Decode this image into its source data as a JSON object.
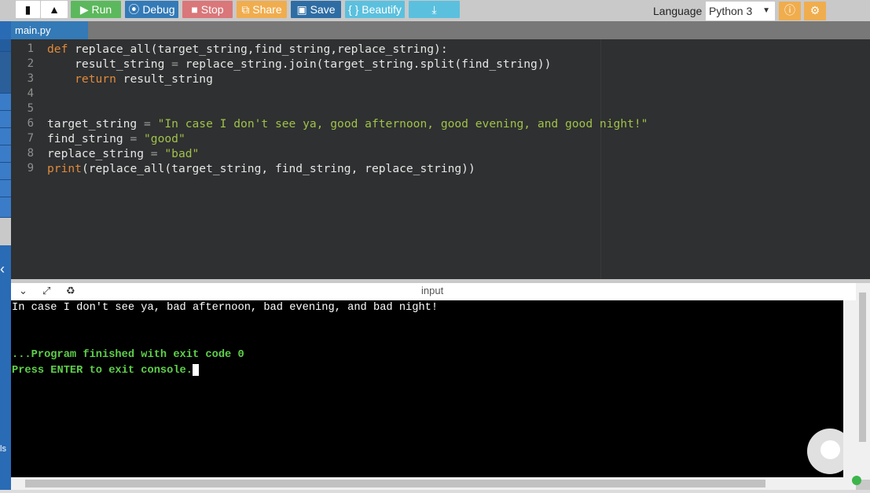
{
  "toolbar": {
    "run": "Run",
    "debug": "Debug",
    "stop": "Stop",
    "share": "Share",
    "save": "Save",
    "beautify": "{ } Beautify",
    "language_label": "Language",
    "language_value": "Python 3"
  },
  "tab": {
    "name": "main.py"
  },
  "code": [
    [
      [
        "kw",
        "def "
      ],
      [
        "",
        "replace_all(target_string,find_string,replace_string):"
      ]
    ],
    [
      [
        "",
        "    result_string "
      ],
      [
        "op",
        "= "
      ],
      [
        "",
        "replace_string.join(target_string.split(find_string))"
      ]
    ],
    [
      [
        "kw",
        "    return "
      ],
      [
        "",
        "result_string"
      ]
    ],
    [],
    [],
    [
      [
        "",
        "target_string "
      ],
      [
        "op",
        "= "
      ],
      [
        "str",
        "\"In case I don't see ya, good afternoon, good evening, and good night!\""
      ]
    ],
    [
      [
        "",
        "find_string "
      ],
      [
        "op",
        "= "
      ],
      [
        "str",
        "\"good\""
      ]
    ],
    [
      [
        "",
        "replace_string "
      ],
      [
        "op",
        "= "
      ],
      [
        "str",
        "\"bad\""
      ]
    ],
    [
      [
        "kw",
        "print"
      ],
      [
        "",
        "(replace_all(target_string, find_string, replace_string))"
      ]
    ]
  ],
  "console": {
    "header": "input",
    "output": "In case I don't see ya, bad afternoon, bad evening, and bad night!",
    "finished": "...Program finished with exit code 0",
    "press_enter": "Press ENTER to exit console.",
    "side_label": "ls"
  },
  "colors": {
    "run": "#5cb85c",
    "debug": "#337ab7",
    "stop": "#d9777a",
    "share": "#f0ad4e",
    "save": "#2e6da4",
    "beautify": "#5bc0de",
    "download": "#5bc0de"
  }
}
